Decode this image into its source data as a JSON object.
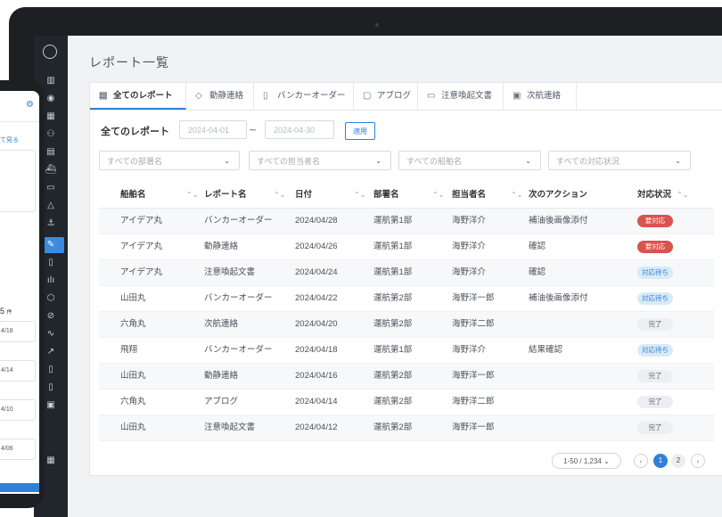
{
  "app": {
    "title": "レポート一覧"
  },
  "tabs": [
    {
      "label": "全てのレポート",
      "icon": "document-icon"
    },
    {
      "label": "動静連絡",
      "icon": "shield-check-icon"
    },
    {
      "label": "バンカーオーダー",
      "icon": "fuel-icon"
    },
    {
      "label": "アブログ",
      "icon": "clipboard-icon"
    },
    {
      "label": "注意喚起文書",
      "icon": "message-icon"
    },
    {
      "label": "次航連絡",
      "icon": "calendar-icon"
    }
  ],
  "filters": {
    "title": "全てのレポート",
    "date_from": "2024-04-01",
    "date_to": "2024-04-30",
    "tilde": "~",
    "apply_label": "適用",
    "department_placeholder": "すべての部署名",
    "person_placeholder": "すべての担当者名",
    "ship_placeholder": "すべての船舶名",
    "status_placeholder": "すべての対応状況"
  },
  "table": {
    "columns": [
      "船舶名",
      "レポート名",
      "日付",
      "部署名",
      "担当者名",
      "次のアクション",
      "対応状況"
    ],
    "rows": [
      {
        "ship": "アイデア丸",
        "report": "バンカーオーダー",
        "date": "2024/04/28",
        "dept": "運航第1部",
        "person": "海野洋介",
        "action": "補油後画像添付",
        "status": "要対応",
        "status_type": "red"
      },
      {
        "ship": "アイデア丸",
        "report": "動静連絡",
        "date": "2024/04/26",
        "dept": "運航第1部",
        "person": "海野洋介",
        "action": "確認",
        "status": "要対応",
        "status_type": "red"
      },
      {
        "ship": "アイデア丸",
        "report": "注意喚起文書",
        "date": "2024/04/24",
        "dept": "運航第1部",
        "person": "海野洋介",
        "action": "確認",
        "status": "対応待ち",
        "status_type": "blue"
      },
      {
        "ship": "山田丸",
        "report": "バンカーオーダー",
        "date": "2024/04/22",
        "dept": "運航第2部",
        "person": "海野洋一郎",
        "action": "補油後画像添付",
        "status": "対応待ち",
        "status_type": "blue"
      },
      {
        "ship": "六角丸",
        "report": "次航連絡",
        "date": "2024/04/20",
        "dept": "運航第2部",
        "person": "海野洋二郎",
        "action": "",
        "status": "完了",
        "status_type": "gray"
      },
      {
        "ship": "飛翔",
        "report": "バンカーオーダー",
        "date": "2024/04/18",
        "dept": "運航第1部",
        "person": "海野洋介",
        "action": "結果確認",
        "status": "対応待ち",
        "status_type": "blue"
      },
      {
        "ship": "山田丸",
        "report": "動静連絡",
        "date": "2024/04/16",
        "dept": "運航第2部",
        "person": "海野洋一郎",
        "action": "",
        "status": "完了",
        "status_type": "gray"
      },
      {
        "ship": "六角丸",
        "report": "アブログ",
        "date": "2024/04/14",
        "dept": "運航第2部",
        "person": "海野洋二郎",
        "action": "",
        "status": "完了",
        "status_type": "gray"
      },
      {
        "ship": "山田丸",
        "report": "注意喚起文書",
        "date": "2024/04/12",
        "dept": "運航第2部",
        "person": "海野洋一郎",
        "action": "",
        "status": "完了",
        "status_type": "gray"
      }
    ]
  },
  "pagination": {
    "info": "1-50 / 1,234",
    "pages": [
      "1",
      "2"
    ],
    "current": "1",
    "prev": "‹",
    "next": "›"
  },
  "phone": {
    "link": "て見る",
    "count": "5",
    "count_unit": "件",
    "items": [
      "4/18",
      "4/14",
      "4/10",
      "4/06"
    ]
  },
  "colors": {
    "accent": "#2f81d8",
    "danger": "#d9534f",
    "sidebar": "#21252c"
  }
}
